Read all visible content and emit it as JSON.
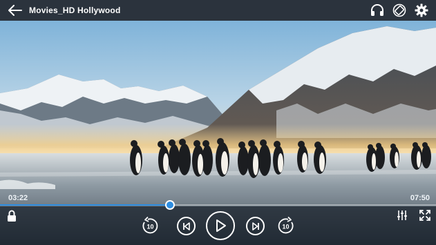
{
  "header": {
    "title": "Movies_HD Hollywood",
    "back_icon": "arrow-left-icon",
    "icons": [
      "headphones-icon",
      "rotate-screen-icon",
      "gear-icon"
    ]
  },
  "player": {
    "current_time": "03:22",
    "total_time": "07:50",
    "progress": 0.39,
    "accent_color": "#2e8de0",
    "lock_icon": "lock-icon",
    "rewind_label": "10",
    "forward_label": "10",
    "buttons": [
      "rewind-10-icon",
      "previous-track-icon",
      "play-icon",
      "next-track-icon",
      "forward-10-icon",
      "equalizer-icon",
      "fullscreen-icon"
    ]
  }
}
